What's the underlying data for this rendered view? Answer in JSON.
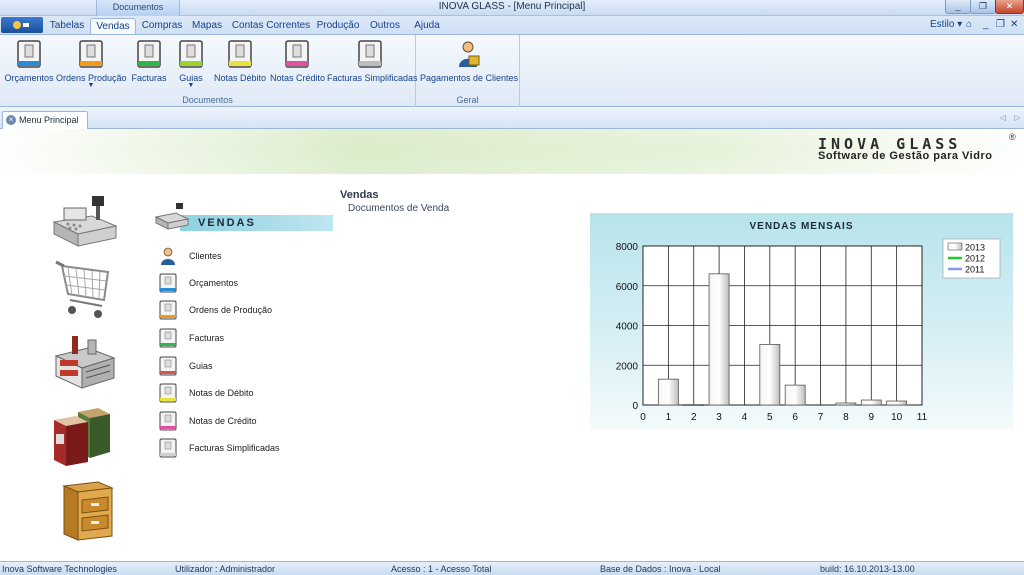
{
  "window": {
    "title": "INOVA GLASS - [Menu Principal]",
    "contextual_tab": "Documentos",
    "min_label": "_",
    "max_label": "❐",
    "close_label": "✕"
  },
  "tabs": [
    {
      "label": "Tabelas"
    },
    {
      "label": "Vendas"
    },
    {
      "label": "Compras"
    },
    {
      "label": "Mapas"
    },
    {
      "label": "Contas Correntes"
    },
    {
      "label": "Produção"
    },
    {
      "label": "Outros"
    },
    {
      "label": "Ajuda"
    }
  ],
  "style_menu": "Estilo ▾",
  "ribbon": {
    "groups": [
      {
        "label": "Documentos",
        "buttons": [
          {
            "label": "Orçamentos",
            "color": "#2a8bd6"
          },
          {
            "label": "Ordens Produção",
            "color": "#f39a1c"
          },
          {
            "label": "Facturas",
            "color": "#2fb54a"
          },
          {
            "label": "Guias",
            "color": "#e8e23a"
          },
          {
            "label": "Notas Débito",
            "color": "#e8e23a"
          },
          {
            "label": "Notas Crédito",
            "color": "#e14fa0"
          },
          {
            "label": "Facturas Simplificadas",
            "color": "#cfcfcf"
          }
        ]
      },
      {
        "label": "Geral",
        "buttons": [
          {
            "label": "Pagamentos de Clientes",
            "icon": "person-money-icon"
          }
        ]
      }
    ]
  },
  "doc_tab": {
    "label": "Menu Principal",
    "nav": "◁ ▷"
  },
  "banner": {
    "logo": "INOVA GLASS",
    "reg": "®",
    "tagline": "Software de Gestão para Vidro"
  },
  "breadcrumb": {
    "title": "Vendas",
    "subtitle": "Documentos de Venda"
  },
  "section": {
    "title": "VENDAS"
  },
  "menu": [
    {
      "label": "Clientes",
      "icon": "person-icon",
      "color": "#2a8bd6"
    },
    {
      "label": "Orçamentos",
      "icon": "document-icon",
      "color": "#2a8bd6"
    },
    {
      "label": "Ordens de Produção",
      "icon": "document-icon",
      "color": "#f39a1c"
    },
    {
      "label": "Facturas",
      "icon": "document-icon",
      "color": "#2fb54a"
    },
    {
      "label": "Guias",
      "icon": "document-icon",
      "color": "#e14f4f"
    },
    {
      "label": "Notas de Débito",
      "icon": "document-icon",
      "color": "#e8e23a"
    },
    {
      "label": "Notas de Crédito",
      "icon": "document-icon",
      "color": "#e14fa0"
    },
    {
      "label": "Facturas Simplificadas",
      "icon": "document-icon",
      "color": "#cfcfcf"
    }
  ],
  "left_icons": [
    "cash-register-icon",
    "shopping-cart-icon",
    "factory-icon",
    "product-boxes-icon",
    "file-cabinet-icon"
  ],
  "chart_data": {
    "type": "bar",
    "title": "VENDAS MENSAIS",
    "x": [
      1,
      2,
      3,
      4,
      5,
      6,
      7,
      8,
      9,
      10
    ],
    "series": [
      {
        "name": "2013",
        "values": [
          1300,
          20,
          6600,
          0,
          3050,
          1000,
          0,
          100,
          250,
          200
        ],
        "color": "#d9d9d9"
      },
      {
        "name": "2012",
        "values": [
          0,
          0,
          0,
          0,
          0,
          0,
          0,
          0,
          0,
          0
        ],
        "color": "#22cc22"
      },
      {
        "name": "2011",
        "values": [
          0,
          0,
          0,
          0,
          0,
          0,
          0,
          0,
          0,
          0
        ],
        "color": "#8899ee"
      }
    ],
    "xlim": [
      0,
      11
    ],
    "ylim": [
      0,
      8000
    ],
    "yticks": [
      0,
      2000,
      4000,
      6000,
      8000
    ],
    "xticks": [
      0,
      1,
      2,
      3,
      4,
      5,
      6,
      7,
      8,
      9,
      10,
      11
    ],
    "grid": true,
    "legend_position": "top-right"
  },
  "status": {
    "company": "Inova Software Technologies",
    "user": "Utilizador : Administrador",
    "access": "Acesso : 1 - Acesso Total",
    "database": "Base de Dados : Inova - Local",
    "build": "build: 16.10.2013-13.00"
  }
}
